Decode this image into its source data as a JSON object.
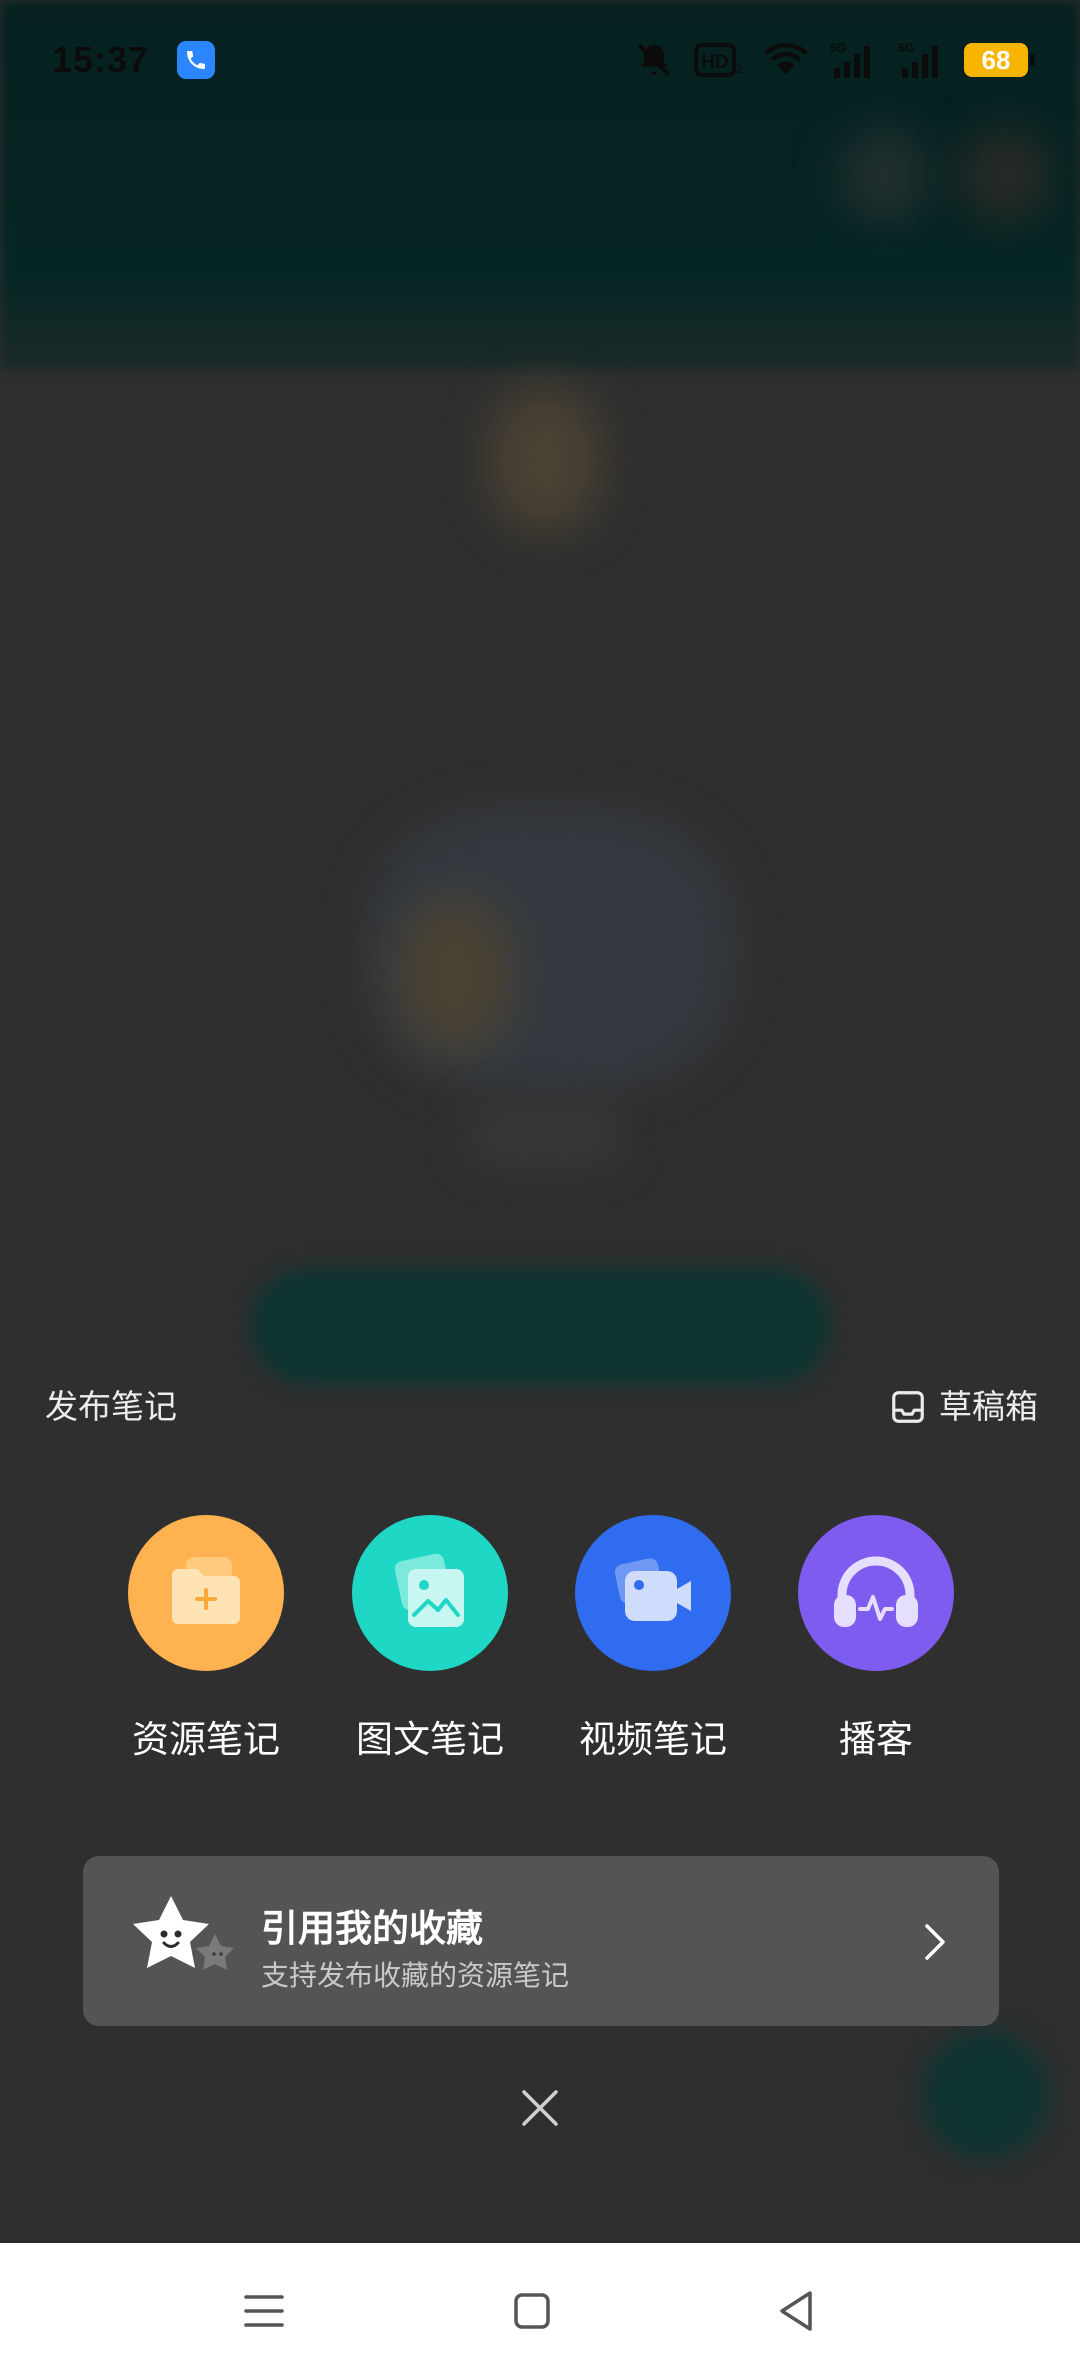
{
  "status_bar": {
    "time": "15:37",
    "battery": "68",
    "icons": [
      "phone-call-icon",
      "mute-bell-icon",
      "hd-icon",
      "wifi-icon",
      "signal-5g-icon",
      "signal-5g-icon"
    ]
  },
  "sheet": {
    "title": "发布笔记",
    "drafts_label": "草稿箱",
    "options": [
      {
        "label": "资源笔记",
        "icon": "folder-plus-icon",
        "color": "#ffb24f"
      },
      {
        "label": "图文笔记",
        "icon": "image-icon",
        "color": "#1ed7c5"
      },
      {
        "label": "视频笔记",
        "icon": "video-camera-icon",
        "color": "#2f6cf0"
      },
      {
        "label": "播客",
        "icon": "headphones-icon",
        "color": "#7e5cf0"
      }
    ],
    "collect_card": {
      "title": "引用我的收藏",
      "subtitle": "支持发布收藏的资源笔记",
      "icon": "star-mascot-icon"
    },
    "close_icon": "close-icon"
  },
  "nav_bar": {
    "buttons": [
      "menu-icon",
      "home-icon",
      "back-icon"
    ]
  },
  "colors": {
    "sheet_bg": "#2b2b2b",
    "card_bg": "#545454",
    "nav_bg": "#ffffff"
  }
}
